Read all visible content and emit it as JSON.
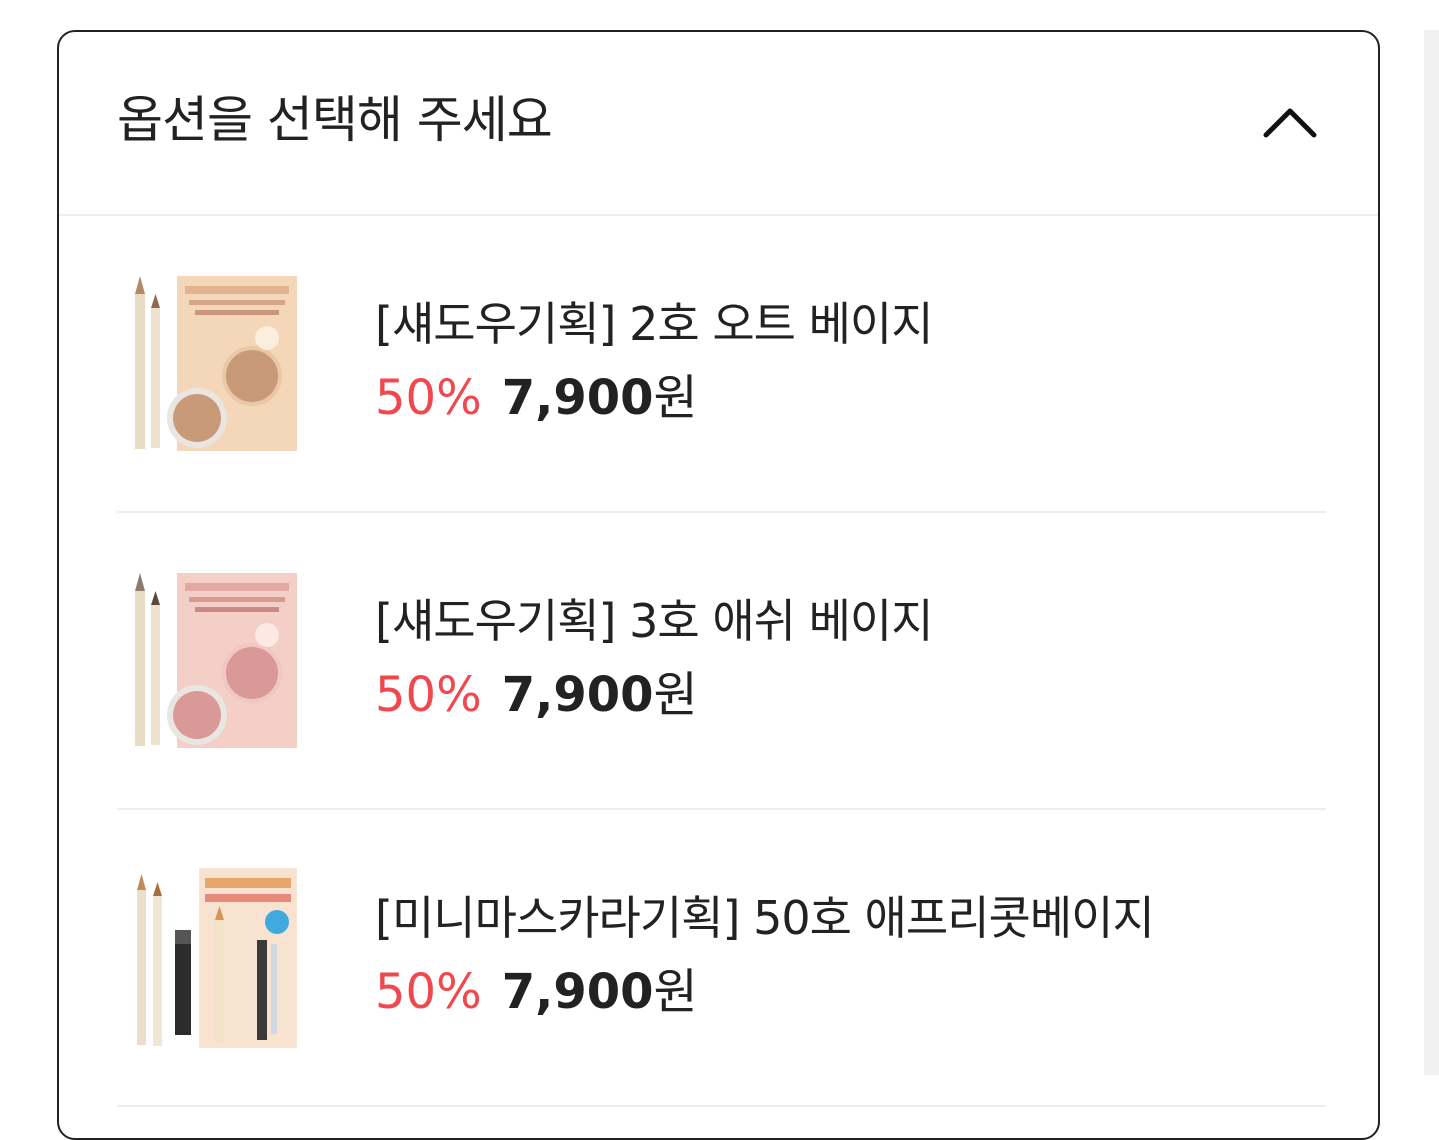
{
  "header": {
    "title": "옵션을 선택해 주세요",
    "toggle_icon": "chevron-up-icon"
  },
  "options": [
    {
      "name": "[섀도우기획] 2호 오트 베이지",
      "discount": "50%",
      "price": "7,900",
      "currency": "원",
      "thumbnail_icon": "product-shadow-set-oat-beige",
      "box_color": "#f3d7b8",
      "pan_color": "#c99a78"
    },
    {
      "name": "[섀도우기획] 3호 애쉬 베이지",
      "discount": "50%",
      "price": "7,900",
      "currency": "원",
      "thumbnail_icon": "product-shadow-set-ash-beige",
      "box_color": "#f3cfc8",
      "pan_color": "#d99996"
    },
    {
      "name": "[미니마스카라기획] 50호 애프리콧베이지",
      "discount": "50%",
      "price": "7,900",
      "currency": "원",
      "thumbnail_icon": "product-mascara-set-apricot-beige",
      "box_color": "#f7e3cf",
      "pan_color": "#e8a66b"
    }
  ],
  "colors": {
    "discount": "#f0484d",
    "text": "#222222",
    "divider": "#eeeeee"
  }
}
